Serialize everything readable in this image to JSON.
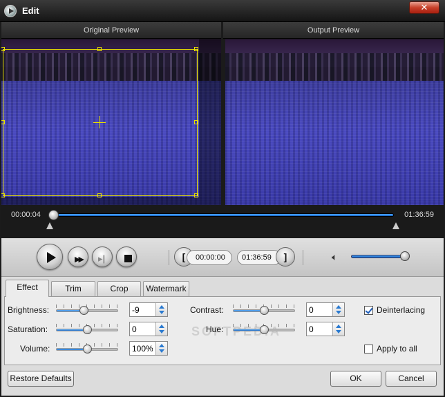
{
  "window": {
    "title": "Edit",
    "close_label": "✕"
  },
  "preview": {
    "original_label": "Original Preview",
    "output_label": "Output Preview"
  },
  "timeline": {
    "current_time": "00:00:04",
    "total_time": "01:36:59",
    "progress": 0.01
  },
  "playback": {
    "start_time": "00:00:00",
    "end_time": "01:36:59",
    "volume": 0.88
  },
  "tabs": [
    {
      "label": "Effect",
      "active": true
    },
    {
      "label": "Trim",
      "active": false
    },
    {
      "label": "Crop",
      "active": false
    },
    {
      "label": "Watermark",
      "active": false
    }
  ],
  "effect": {
    "brightness": {
      "label": "Brightness:",
      "value": "-9",
      "level": 0.45
    },
    "saturation": {
      "label": "Saturation:",
      "value": "0",
      "level": 0.5
    },
    "volume": {
      "label": "Volume:",
      "value": "100%",
      "level": 0.5
    },
    "contrast": {
      "label": "Contrast:",
      "value": "0",
      "level": 0.5
    },
    "hue": {
      "label": "Hue:",
      "value": "0",
      "level": 0.5
    },
    "deinterlacing": {
      "label": "Deinterlacing",
      "checked": true
    },
    "apply_all": {
      "label": "Apply to all",
      "checked": false
    }
  },
  "footer": {
    "restore_label": "Restore Defaults",
    "ok_label": "OK",
    "cancel_label": "Cancel"
  }
}
